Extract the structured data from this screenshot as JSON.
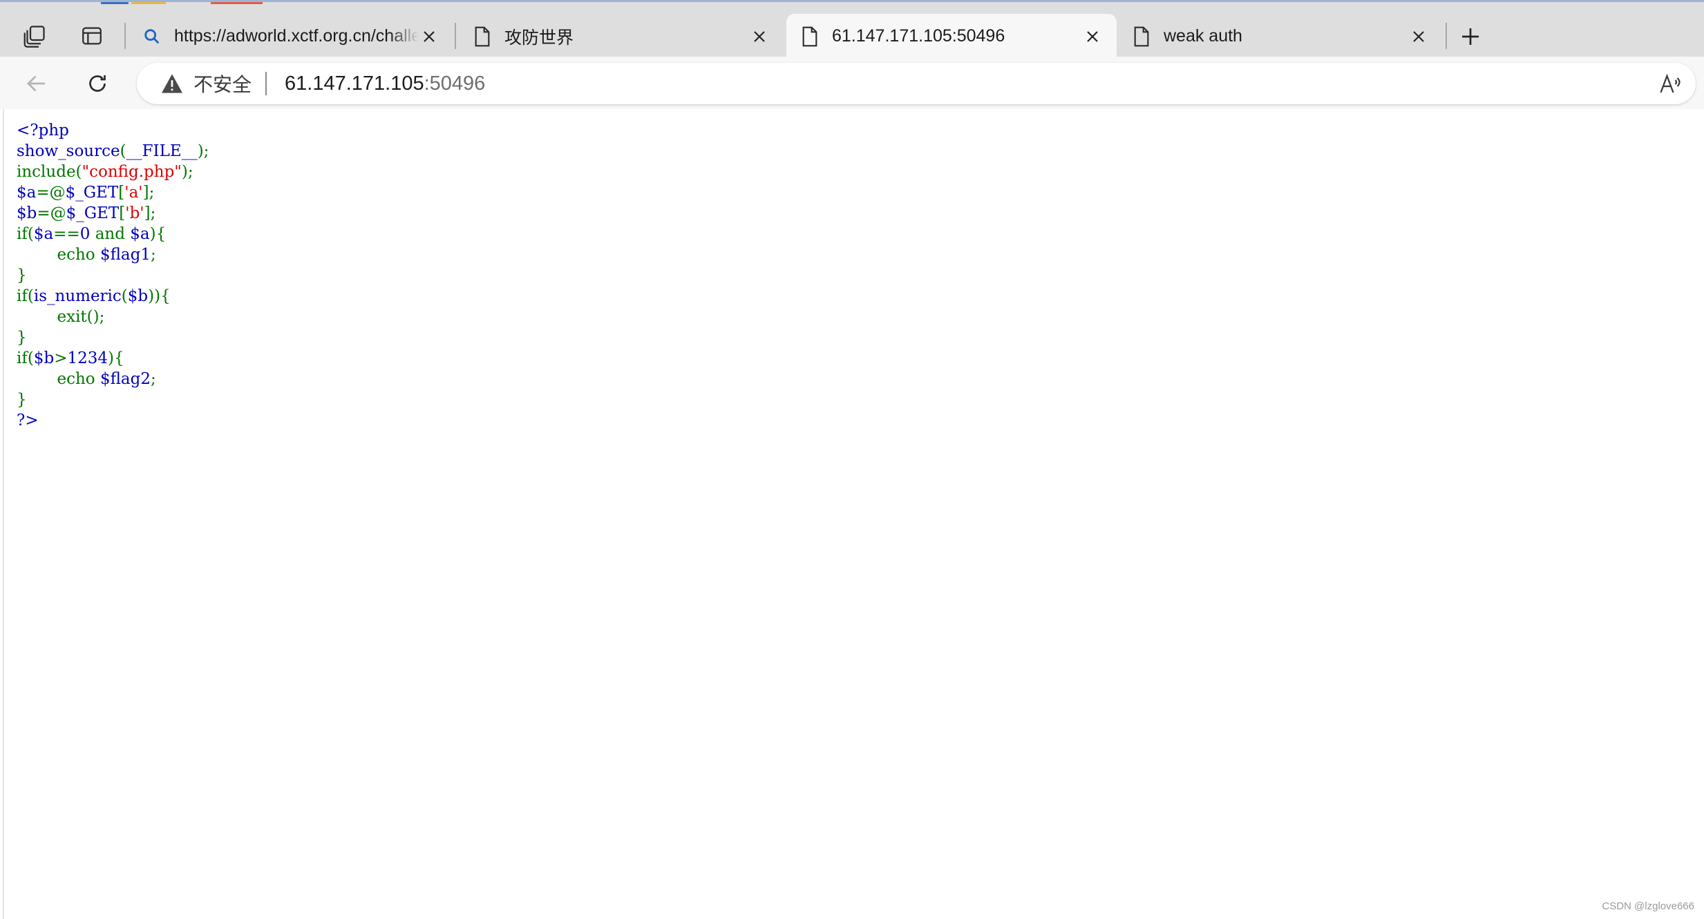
{
  "browser": {
    "tabs": [
      {
        "title": "https://adworld.xctf.org.cn/challenges/list",
        "icon": "search-icon",
        "active": false
      },
      {
        "title": "攻防世界",
        "icon": "page-icon",
        "active": false
      },
      {
        "title": "61.147.171.105:50496",
        "icon": "page-icon",
        "active": true
      },
      {
        "title": "weak auth",
        "icon": "page-icon",
        "active": false
      }
    ],
    "new_tab_icon": "plus-icon",
    "address": {
      "security_label": "不安全",
      "security_icon": "warning-icon",
      "host": "61.147.171.105",
      "port": ":50496"
    },
    "toolbar_icons": [
      "back-arrow-icon",
      "refresh-icon",
      "read-aloud-icon"
    ]
  },
  "source_code": {
    "lines": [
      [
        {
          "t": "<?php",
          "c": "default"
        }
      ],
      [
        {
          "t": "show_source",
          "c": "default"
        },
        {
          "t": "(",
          "c": "keyword"
        },
        {
          "t": "__FILE__",
          "c": "default"
        },
        {
          "t": ");",
          "c": "keyword"
        }
      ],
      [
        {
          "t": "include(",
          "c": "keyword"
        },
        {
          "t": "\"config.php\"",
          "c": "string"
        },
        {
          "t": ");",
          "c": "keyword"
        }
      ],
      [
        {
          "t": "$a",
          "c": "default"
        },
        {
          "t": "=@",
          "c": "keyword"
        },
        {
          "t": "$_GET",
          "c": "default"
        },
        {
          "t": "[",
          "c": "keyword"
        },
        {
          "t": "'a'",
          "c": "string"
        },
        {
          "t": "];",
          "c": "keyword"
        }
      ],
      [
        {
          "t": "$b",
          "c": "default"
        },
        {
          "t": "=@",
          "c": "keyword"
        },
        {
          "t": "$_GET",
          "c": "default"
        },
        {
          "t": "[",
          "c": "keyword"
        },
        {
          "t": "'b'",
          "c": "string"
        },
        {
          "t": "];",
          "c": "keyword"
        }
      ],
      [
        {
          "t": "if(",
          "c": "keyword"
        },
        {
          "t": "$a",
          "c": "default"
        },
        {
          "t": "==",
          "c": "keyword"
        },
        {
          "t": "0",
          "c": "default"
        },
        {
          "t": " and ",
          "c": "keyword"
        },
        {
          "t": "$a",
          "c": "default"
        },
        {
          "t": "){",
          "c": "keyword"
        }
      ],
      [
        {
          "t": "        echo ",
          "c": "keyword"
        },
        {
          "t": "$flag1",
          "c": "default"
        },
        {
          "t": ";",
          "c": "keyword"
        }
      ],
      [
        {
          "t": "}",
          "c": "keyword"
        }
      ],
      [
        {
          "t": "if(",
          "c": "keyword"
        },
        {
          "t": "is_numeric",
          "c": "default"
        },
        {
          "t": "(",
          "c": "keyword"
        },
        {
          "t": "$b",
          "c": "default"
        },
        {
          "t": ")){",
          "c": "keyword"
        }
      ],
      [
        {
          "t": "        exit",
          "c": "keyword"
        },
        {
          "t": "();",
          "c": "keyword"
        }
      ],
      [
        {
          "t": "}",
          "c": "keyword"
        }
      ],
      [
        {
          "t": "if(",
          "c": "keyword"
        },
        {
          "t": "$b",
          "c": "default"
        },
        {
          "t": ">",
          "c": "keyword"
        },
        {
          "t": "1234",
          "c": "default"
        },
        {
          "t": "){",
          "c": "keyword"
        }
      ],
      [
        {
          "t": "        echo ",
          "c": "keyword"
        },
        {
          "t": "$flag2",
          "c": "default"
        },
        {
          "t": ";",
          "c": "keyword"
        }
      ],
      [
        {
          "t": "}",
          "c": "keyword"
        }
      ],
      [
        {
          "t": "?>",
          "c": "default"
        }
      ]
    ]
  },
  "watermark": "CSDN @lzglove666",
  "colors": {
    "php_default": "#0000bb",
    "php_keyword": "#007700",
    "php_string": "#dd0000",
    "tabstrip_bg": "#dedede",
    "toolbar_bg": "#f7f7f7"
  }
}
